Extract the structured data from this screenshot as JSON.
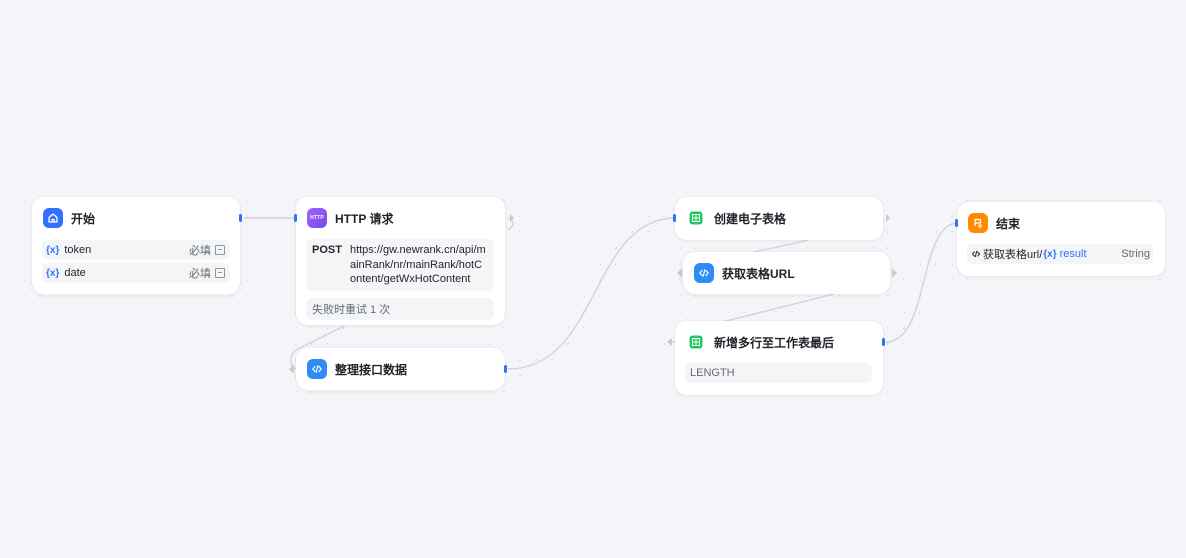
{
  "colors": {
    "accent": "#3370ff",
    "start_icon": "#3370ff",
    "http_icon": "#8f4bf6",
    "sheet_icon": "#22c55e",
    "code_icon": "#2f8cf7",
    "end_icon": "#ff8a00",
    "edge": "#cfd3db"
  },
  "nodes": {
    "start": {
      "title": "开始",
      "icon": "home-icon",
      "inputs": [
        {
          "name": "token",
          "required": "必填"
        },
        {
          "name": "date",
          "required": "必填"
        }
      ]
    },
    "http": {
      "title": "HTTP 请求",
      "icon": "http-icon",
      "icon_text": "HTTP",
      "method": "POST",
      "url": "https://gw.newrank.cn/api/mainRank/nr/mainRank/hotContent/getWxHotContent",
      "retry": "失败时重试 1 次"
    },
    "process": {
      "title": "整理接口数据",
      "icon": "code-icon"
    },
    "create_sheet": {
      "title": "创建电子表格",
      "icon": "sheet-icon"
    },
    "get_url": {
      "title": "获取表格URL",
      "icon": "code-icon"
    },
    "append_rows": {
      "title": "新增多行至工作表最后",
      "icon": "sheet-icon",
      "field": "LENGTH"
    },
    "end": {
      "title": "结束",
      "icon": "end-icon",
      "output": {
        "source": "获取表格url/",
        "var_icon": "{x}",
        "variable": "result",
        "type": "String"
      }
    }
  }
}
